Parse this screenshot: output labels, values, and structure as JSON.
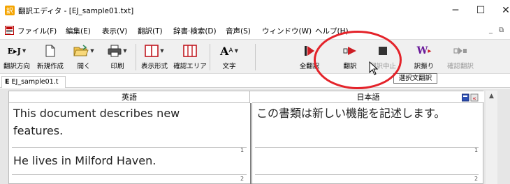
{
  "window": {
    "title": "翻訳エディタ - [EJ_sample01.txt]",
    "min_glyph": "─",
    "max_glyph": "☐",
    "close_glyph": "✕"
  },
  "menubar": {
    "items": [
      "ファイル(F)",
      "編集(E)",
      "表示(V)",
      "翻訳(T)",
      "辞書·検索(D)",
      "音声(S)",
      "ウィンドウ(W)",
      "ヘルプ(H)"
    ],
    "mdi_min": "_",
    "mdi_restore": "⧉"
  },
  "toolbar": {
    "buttons": [
      {
        "label": "翻訳方向",
        "icon": "translation-direction-icon",
        "enabled": true
      },
      {
        "label": "新規作成",
        "icon": "new-document-icon",
        "enabled": true
      },
      {
        "label": "開く",
        "icon": "open-folder-icon",
        "enabled": true
      },
      {
        "label": "印刷",
        "icon": "printer-icon",
        "enabled": true
      },
      {
        "label": "表示形式",
        "icon": "display-format-icon",
        "enabled": true
      },
      {
        "label": "確認エリア",
        "icon": "confirm-area-icon",
        "enabled": true
      },
      {
        "label": "文字",
        "icon": "font-icon",
        "enabled": true
      },
      {
        "label": "全翻訳",
        "icon": "translate-all-icon",
        "enabled": true
      },
      {
        "label": "翻訳",
        "icon": "translate-icon",
        "enabled": true
      },
      {
        "label": "翻訳中止",
        "icon": "stop-translation-icon",
        "enabled": false
      },
      {
        "label": "訳振り",
        "icon": "translation-ruby-icon",
        "enabled": true
      },
      {
        "label": "確認翻訳",
        "icon": "confirm-translation-icon",
        "enabled": false
      }
    ],
    "tooltip": "選択文翻訳",
    "direction_glyph": "E▸J"
  },
  "tabs": {
    "active": "EJ_sample01.t",
    "tab_marker": "E"
  },
  "editor": {
    "source_header": "英語",
    "target_header": "日本語",
    "segments": [
      {
        "source": [
          "This document describes new",
          "features."
        ],
        "target": [
          "この書類は新しい機能を記述します。"
        ],
        "number": "1"
      },
      {
        "source": [
          "He lives in Milford Haven."
        ],
        "target": [
          ""
        ],
        "number": "2"
      }
    ],
    "scroll_up_glyph": "▲"
  },
  "colors": {
    "highlight": "#e4232a",
    "translate_red": "#cc1d24",
    "toolbar_bg": "#f0f0f0"
  }
}
